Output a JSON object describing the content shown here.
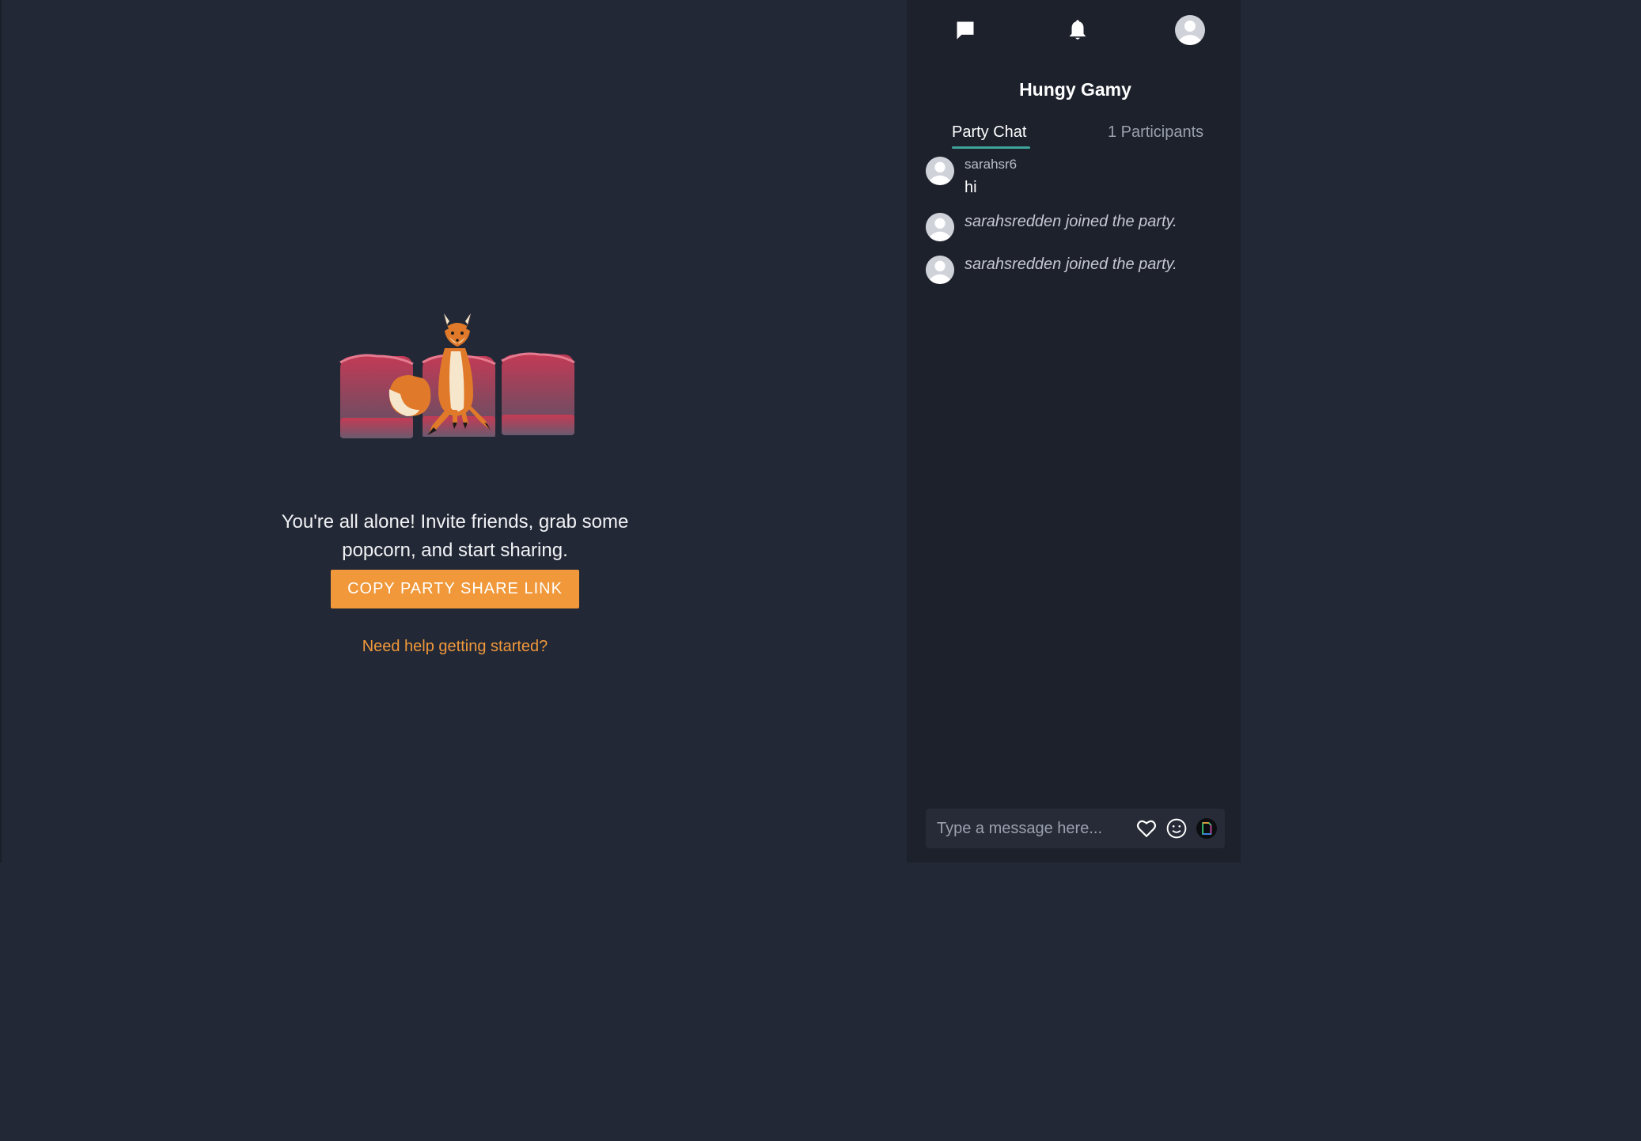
{
  "main": {
    "empty_message": "You're all alone! Invite friends, grab some popcorn, and start sharing.",
    "copy_button": "COPY PARTY SHARE LINK",
    "help_link": "Need help getting started?"
  },
  "sidebar": {
    "icons": [
      "chat-icon",
      "bell-icon",
      "user-avatar-icon"
    ],
    "party_name": "Hungy Gamy",
    "tabs": [
      {
        "label": "Party Chat",
        "active": true
      },
      {
        "label": "1 Participants",
        "active": false
      }
    ],
    "messages": [
      {
        "type": "user",
        "user": "sarahsr6",
        "text": "hi"
      },
      {
        "type": "system",
        "text": "sarahsredden joined the party."
      },
      {
        "type": "system",
        "text": "sarahsredden joined the party."
      }
    ],
    "composer": {
      "placeholder": "Type a message here...",
      "icons": [
        "heart-icon",
        "emoji-icon",
        "sticker-icon"
      ]
    }
  },
  "colors": {
    "background": "#232836",
    "sidebar": "#1d212c",
    "accent": "#f0983a",
    "tab_underline": "#3fa39b"
  }
}
